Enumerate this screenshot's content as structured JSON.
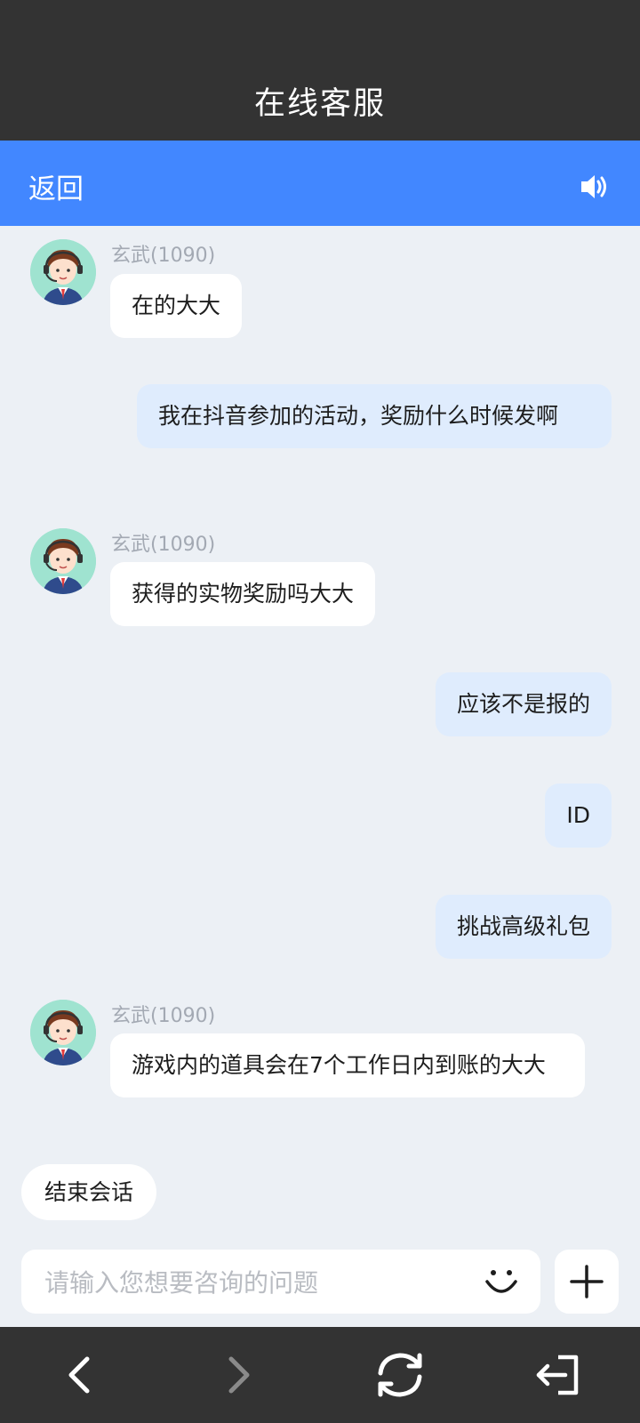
{
  "header": {
    "title": "在线客服"
  },
  "nav": {
    "back_label": "返回",
    "sound_icon": "speaker-icon"
  },
  "colors": {
    "header_bg": "#333333",
    "nav_bg": "#4287ff",
    "agent_bubble": "#ffffff",
    "user_bubble": "#dfecfd",
    "chat_bg": "#ecf0f5"
  },
  "messages": [
    {
      "from": "agent",
      "name": "玄武(1090)",
      "text": "在的大大"
    },
    {
      "from": "user",
      "text": "我在抖音参加的活动，奖励什么时候发啊"
    },
    {
      "from": "agent",
      "name": "玄武(1090)",
      "text": "获得的实物奖励吗大大"
    },
    {
      "from": "user",
      "text": "应该不是报的"
    },
    {
      "from": "user",
      "text": "ID"
    },
    {
      "from": "user",
      "text": "挑战高级礼包"
    },
    {
      "from": "agent",
      "name": "玄武(1090)",
      "text": "游戏内的道具会在7个工作日内到账的大大"
    }
  ],
  "quick_action": {
    "end_session_label": "结束会话"
  },
  "composer": {
    "placeholder": "请输入您想要咨询的问题",
    "emoji_icon": "smile-icon",
    "plus_icon": "plus-icon"
  },
  "bottom_nav": {
    "icons": [
      "back-arrow-icon",
      "forward-arrow-icon",
      "refresh-icon",
      "exit-icon"
    ]
  }
}
